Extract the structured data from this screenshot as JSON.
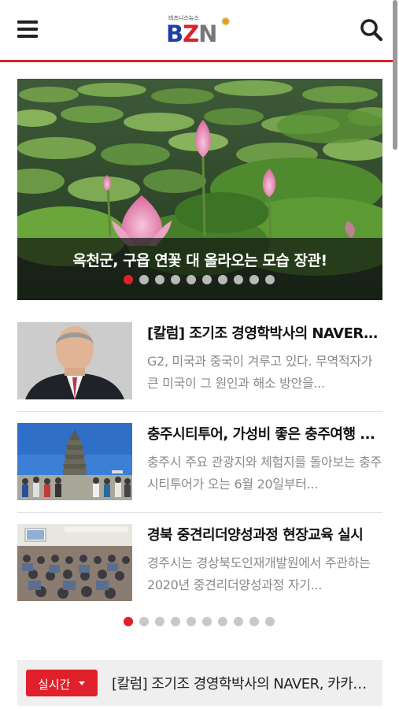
{
  "header": {
    "menu_icon": "hamburger-menu-icon",
    "logo_small_text": "비즈니스뉴스",
    "logo_letters": {
      "b": "B",
      "z": "Z",
      "n": "N"
    },
    "search_icon": "search-icon",
    "accent_color": "#d8232a"
  },
  "hero": {
    "caption": "옥천군, 구읍 연꽃 대 올라오는 모습 장관!",
    "slide_count": 10,
    "active_slide": 1
  },
  "news": {
    "items": [
      {
        "title": "[칼럼] 조기조 경영학박사의 NAVER, ...",
        "desc": "G2, 미국과 중국이 겨루고 있다. 무역적자가 큰 미국이 그 원인과 해소 방안을..."
      },
      {
        "title": "충주시티투어, 가성비 좋은 충주여행 ...",
        "desc": "충주시 주요 관광지와 체험지를 돌아보는 충주시티투어가 오는 6월 20일부터..."
      },
      {
        "title": "경북 중견리더양성과정 현장교육 실시",
        "desc": "경주시는 경상북도인재개발원에서 주관하는 2020년 중견리더양성과정 자기..."
      }
    ],
    "page_count": 10,
    "active_page": 1
  },
  "ticker": {
    "badge_label": "실시간",
    "text": "[칼럼] 조기조 경영학박사의 NAVER, 카카오..."
  },
  "colors": {
    "accent": "#e0202a",
    "brand_blue": "#1d3fa8"
  }
}
